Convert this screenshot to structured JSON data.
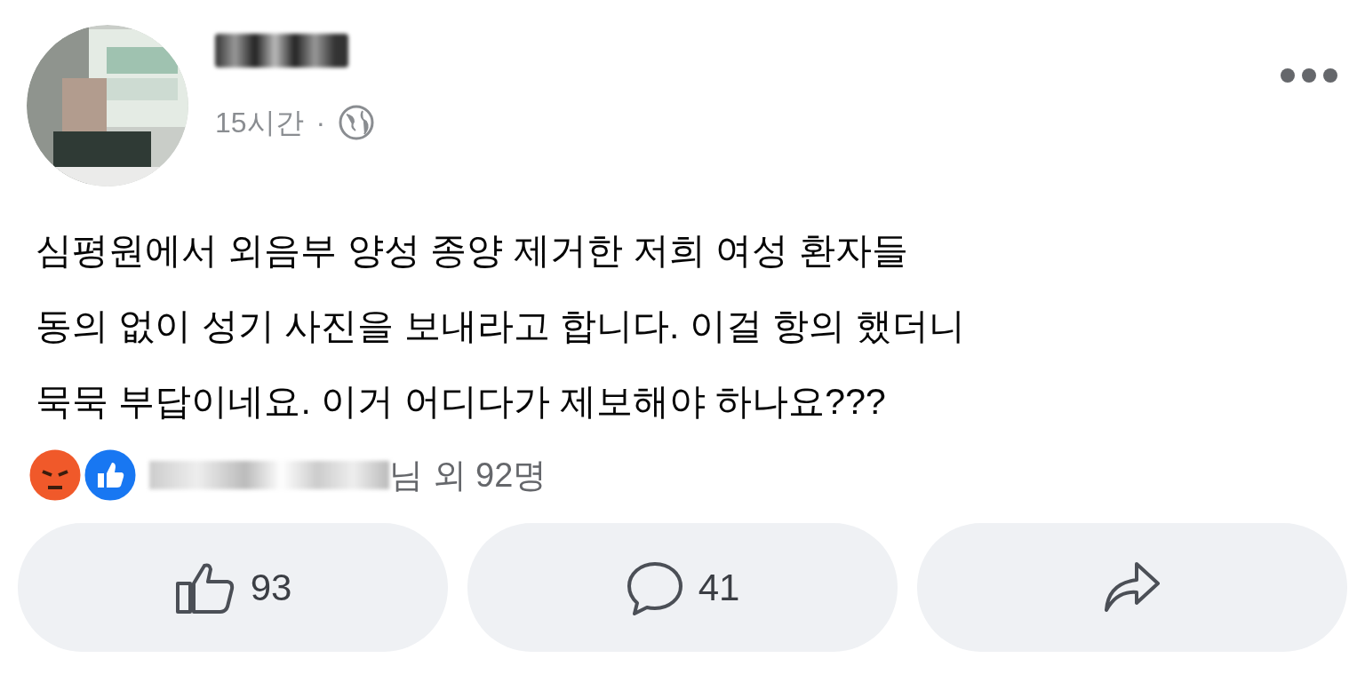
{
  "post": {
    "time": "15시간",
    "separator": "·",
    "text_lines": [
      "심평원에서 외음부 양성 종양 제거한 저희 여성 환자들",
      "동의 없이 성기 사진을 보내라고 합니다. 이걸 항의 했더니",
      "묵묵 부답이네요. 이거 어디다가 제보해야 하나요???"
    ],
    "reactions": {
      "summary": "님 외 92명"
    },
    "actions": [
      {
        "kind": "like",
        "count": "93"
      },
      {
        "kind": "comment",
        "count": "41"
      },
      {
        "kind": "share"
      }
    ]
  }
}
